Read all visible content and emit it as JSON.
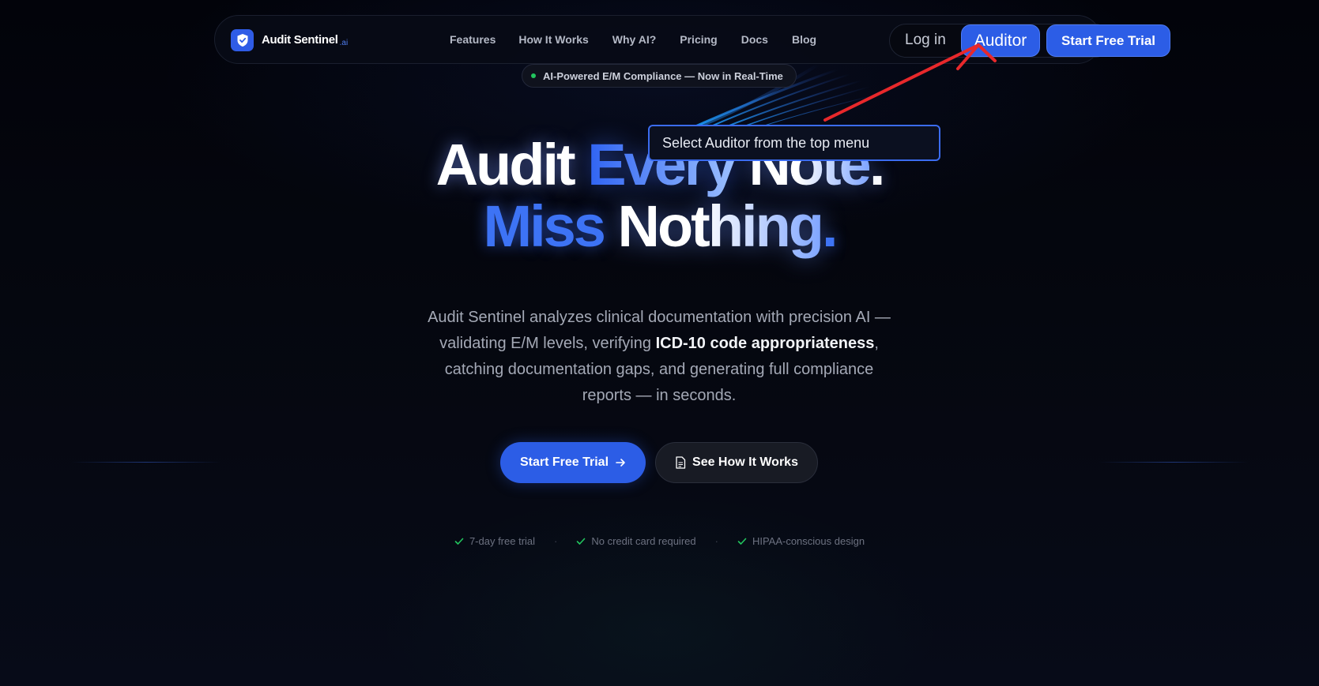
{
  "brand": {
    "name": "Audit Sentinel",
    "tld": ".ai",
    "accent_color": "#2c5de6",
    "icon": "shield-check-icon"
  },
  "nav": {
    "links": [
      "Features",
      "How It Works",
      "Why AI?",
      "Pricing",
      "Docs",
      "Blog"
    ],
    "login_label": "Log in",
    "auditor_label": "Auditor",
    "trial_label": "Start Free Trial"
  },
  "badge": {
    "text": "AI-Powered E/M Compliance — Now in Real-Time",
    "dot_color": "#22c55e"
  },
  "hero": {
    "line1_word1": "Audit",
    "line1_word2": "Every",
    "line1_word3": "Note",
    "line1_dot": ".",
    "line2_word1": "Miss",
    "line2_word2": "Nothing",
    "line2_dot": ".",
    "paragraph_part1": "Audit Sentinel analyzes clinical documentation with precision AI — validating E/M levels, verifying ",
    "paragraph_bold": "ICD-10 code appropriateness",
    "paragraph_part2": ", catching documentation gaps, and generating full compliance reports — in seconds."
  },
  "cta": {
    "primary_label": "Start Free Trial",
    "primary_icon": "arrow-right-icon",
    "secondary_label": "See How It Works",
    "secondary_icon": "document-icon"
  },
  "perks": [
    "7-day free trial",
    "No credit card required",
    "HIPAA-conscious design"
  ],
  "perk_separator": "·",
  "annotation": {
    "tooltip_text": "Select Auditor from the top menu",
    "arrow_color": "#e8282b"
  }
}
